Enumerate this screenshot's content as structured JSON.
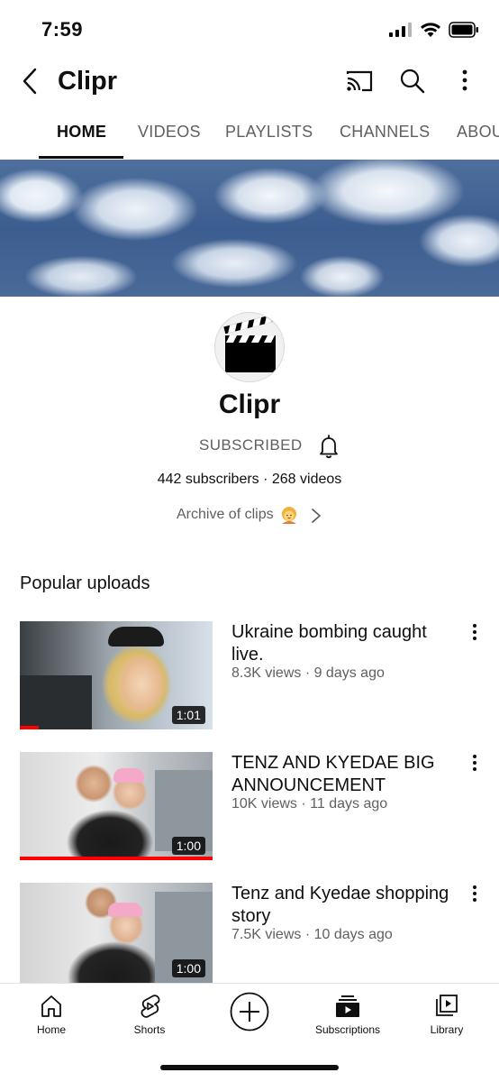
{
  "status_bar": {
    "time": "7:59",
    "icons": [
      "cellular-signal-icon",
      "wifi-icon",
      "battery-icon"
    ]
  },
  "app_bar": {
    "title": "Clipr",
    "icons": [
      "back-arrow-icon",
      "cast-icon",
      "search-icon",
      "more-vertical-icon"
    ]
  },
  "tabs": [
    {
      "label": "HOME",
      "active": true
    },
    {
      "label": "VIDEOS",
      "active": false
    },
    {
      "label": "PLAYLISTS",
      "active": false
    },
    {
      "label": "CHANNELS",
      "active": false
    },
    {
      "label": "ABOUT",
      "active": false
    }
  ],
  "channel": {
    "name": "Clipr",
    "subscribe_label": "SUBSCRIBED",
    "stats": "442 subscribers · 268 videos",
    "description": "Archive of clips",
    "avatar_icon": "clapperboard-icon"
  },
  "popular": {
    "title": "Popular uploads",
    "videos": [
      {
        "title": "Ukraine bombing caught live.",
        "meta": "8.3K views · 9 days ago",
        "duration": "1:01",
        "watched_fraction": 0.1
      },
      {
        "title": "TENZ AND KYEDAE BIG ANNOUNCEMENT",
        "meta": "10K views · 11 days ago",
        "duration": "1:00",
        "watched_fraction": 1.0
      },
      {
        "title": "Tenz and Kyedae shopping story",
        "meta": "7.5K views · 10 days ago",
        "duration": "1:00",
        "watched_fraction": 0.0
      }
    ]
  },
  "bottom_nav": {
    "items": [
      {
        "label": "Home",
        "icon": "home-icon"
      },
      {
        "label": "Shorts",
        "icon": "shorts-icon"
      },
      {
        "label": "",
        "icon": "create-plus-icon"
      },
      {
        "label": "Subscriptions",
        "icon": "subscriptions-icon"
      },
      {
        "label": "Library",
        "icon": "library-icon"
      }
    ]
  },
  "colors": {
    "accent_red": "#ff0000",
    "text_primary": "#0f0f0f",
    "text_secondary": "#606060"
  }
}
